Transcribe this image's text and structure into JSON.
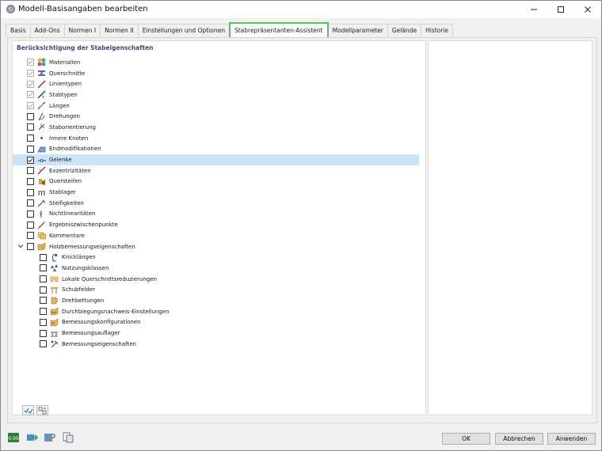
{
  "window": {
    "title": "Modell-Basisangaben bearbeiten"
  },
  "tabs": [
    {
      "label": "Basis",
      "active": false
    },
    {
      "label": "Add-Ons",
      "active": false
    },
    {
      "label": "Normen I",
      "active": false
    },
    {
      "label": "Normen II",
      "active": false
    },
    {
      "label": "Einstellungen und Optionen",
      "active": false
    },
    {
      "label": "Stabrepräsentanten-Assistent",
      "active": true
    },
    {
      "label": "Modellparameter",
      "active": false
    },
    {
      "label": "Gelände",
      "active": false
    },
    {
      "label": "Historie",
      "active": false
    }
  ],
  "section": {
    "title": "Berücksichtigung der Stabeigenschaften"
  },
  "tree": [
    {
      "label": "Materialien",
      "state": "checked-disabled",
      "level": 0,
      "icon": "materials-icon"
    },
    {
      "label": "Querschnitte",
      "state": "checked-disabled",
      "level": 0,
      "icon": "cross-sections-icon"
    },
    {
      "label": "Linientypen",
      "state": "checked-disabled",
      "level": 0,
      "icon": "line-types-icon"
    },
    {
      "label": "Stabtypen",
      "state": "checked-disabled",
      "level": 0,
      "icon": "member-types-icon"
    },
    {
      "label": "Längen",
      "state": "checked-disabled",
      "level": 0,
      "icon": "lengths-icon"
    },
    {
      "label": "Drehungen",
      "state": "unchecked",
      "level": 0,
      "icon": "rotations-icon"
    },
    {
      "label": "Staborientierung",
      "state": "unchecked",
      "level": 0,
      "icon": "member-orientation-icon"
    },
    {
      "label": "Innere Knoten",
      "state": "unchecked",
      "level": 0,
      "icon": "inner-nodes-icon"
    },
    {
      "label": "Endmodifikationen",
      "state": "unchecked",
      "level": 0,
      "icon": "end-modifications-icon"
    },
    {
      "label": "Gelenke",
      "state": "checked",
      "level": 0,
      "icon": "hinges-icon",
      "selected": true
    },
    {
      "label": "Exzentrizitäten",
      "state": "unchecked",
      "level": 0,
      "icon": "eccentricities-icon"
    },
    {
      "label": "Quersteifen",
      "state": "unchecked",
      "level": 0,
      "icon": "transverse-stiffeners-icon"
    },
    {
      "label": "Stablager",
      "state": "unchecked",
      "level": 0,
      "icon": "member-supports-icon"
    },
    {
      "label": "Steifigkeiten",
      "state": "unchecked",
      "level": 0,
      "icon": "stiffnesses-icon"
    },
    {
      "label": "Nichtlinearitäten",
      "state": "unchecked",
      "level": 0,
      "icon": "nonlinearities-icon"
    },
    {
      "label": "Ergebniszwischenpunkte",
      "state": "unchecked",
      "level": 0,
      "icon": "result-intermediate-points-icon"
    },
    {
      "label": "Kommentare",
      "state": "unchecked",
      "level": 0,
      "icon": "comments-icon"
    },
    {
      "label": "Holzbemessungseigenschaften",
      "state": "unchecked",
      "level": 0,
      "icon": "timber-design-icon",
      "expandable": true
    },
    {
      "label": "Knicklängen",
      "state": "unchecked",
      "level": 1,
      "icon": "buckling-lengths-icon"
    },
    {
      "label": "Nutzungsklassen",
      "state": "unchecked",
      "level": 1,
      "icon": "service-classes-icon"
    },
    {
      "label": "Lokale Querschnittsreduzierungen",
      "state": "unchecked",
      "level": 1,
      "icon": "local-section-reductions-icon"
    },
    {
      "label": "Schubfelder",
      "state": "unchecked",
      "level": 1,
      "icon": "shear-panels-icon"
    },
    {
      "label": "Drehbettungen",
      "state": "unchecked",
      "level": 1,
      "icon": "rotational-restraints-icon"
    },
    {
      "label": "Durchbiegungsnachweis-Einstellungen",
      "state": "unchecked",
      "level": 1,
      "icon": "deflection-settings-icon"
    },
    {
      "label": "Bemessungskonfigurationen",
      "state": "unchecked",
      "level": 1,
      "icon": "design-configurations-icon"
    },
    {
      "label": "Bemessungsauflager",
      "state": "unchecked",
      "level": 1,
      "icon": "design-supports-icon"
    },
    {
      "label": "Bemessungseigenschaften",
      "state": "unchecked",
      "level": 1,
      "icon": "design-properties-icon"
    }
  ],
  "buttons": {
    "ok": "OK",
    "cancel": "Abbrechen",
    "apply": "Anwenden"
  },
  "footer": {
    "units_text": "0.00"
  },
  "colors": {
    "active_tab_border": "#5cc25c",
    "selection": "#cce4f7",
    "section_title": "#3b4a7a"
  }
}
